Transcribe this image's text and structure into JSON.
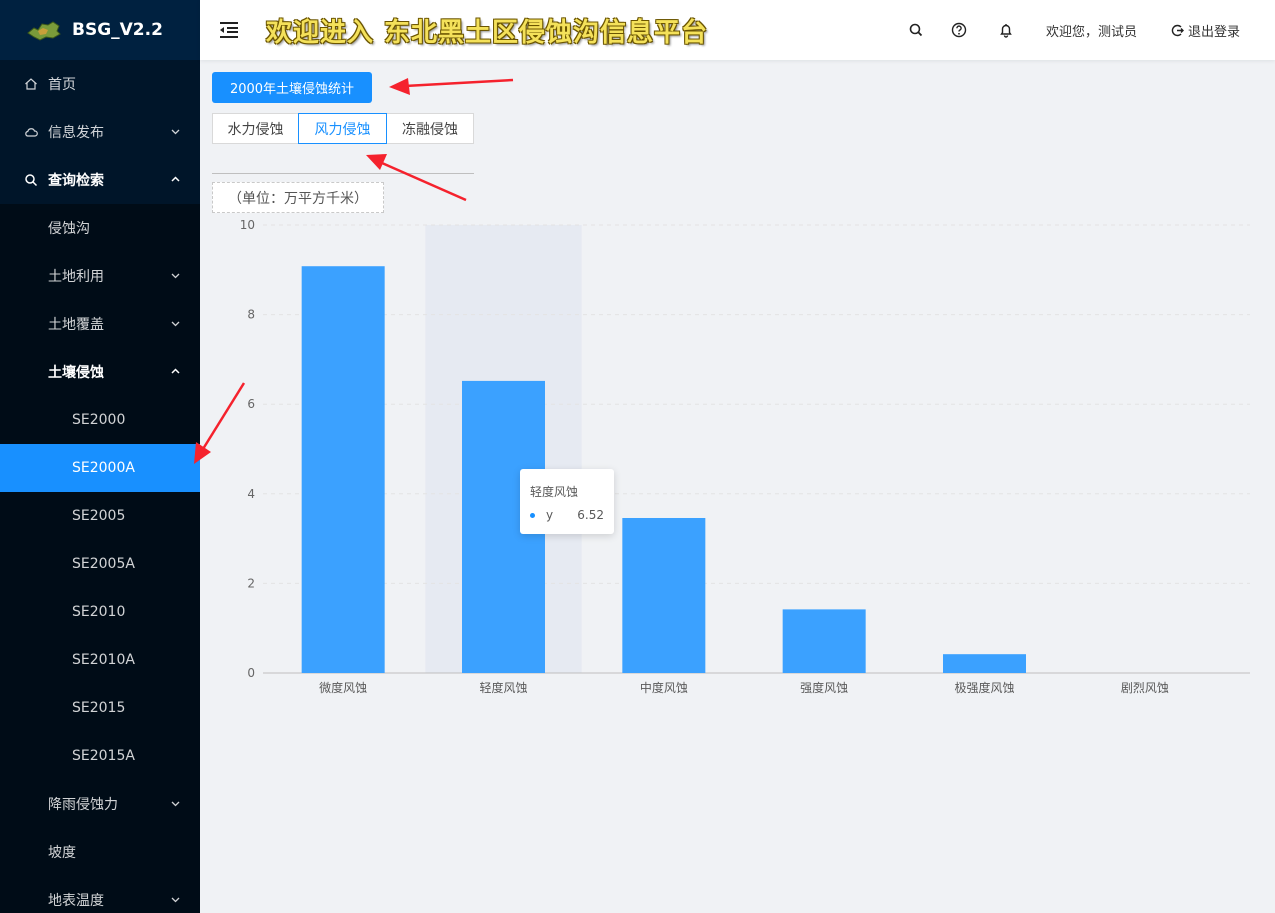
{
  "app": {
    "name": "BSG_V2.2"
  },
  "sidebar": {
    "items": [
      {
        "label": "首页",
        "icon": "home-icon"
      },
      {
        "label": "信息发布",
        "icon": "cloud-icon"
      },
      {
        "label": "查询检索",
        "icon": "search-icon"
      },
      {
        "label": "侵蚀沟"
      },
      {
        "label": "土地利用"
      },
      {
        "label": "土地覆盖"
      },
      {
        "label": "土壤侵蚀"
      },
      {
        "label": "SE2000"
      },
      {
        "label": "SE2000A"
      },
      {
        "label": "SE2005"
      },
      {
        "label": "SE2005A"
      },
      {
        "label": "SE2010"
      },
      {
        "label": "SE2010A"
      },
      {
        "label": "SE2015"
      },
      {
        "label": "SE2015A"
      },
      {
        "label": "降雨侵蚀力"
      },
      {
        "label": "坡度"
      },
      {
        "label": "地表温度"
      }
    ],
    "selected": "SE2000A"
  },
  "header": {
    "title": "欢迎进入 东北黑土区侵蚀沟信息平台",
    "welcome": "欢迎您，测试员",
    "logout": "退出登录"
  },
  "main": {
    "stat_button": "2000年土壤侵蚀统计",
    "tabs": [
      {
        "label": "水力侵蚀",
        "active": false
      },
      {
        "label": "风力侵蚀",
        "active": true
      },
      {
        "label": "冻融侵蚀",
        "active": false
      }
    ],
    "unit_label": "（单位：万平方千米）"
  },
  "colors": {
    "sidebar": "#001529",
    "accent": "#1890ff",
    "bar": "#3ba1ff",
    "arrow": "#f5222d"
  },
  "chart_data": {
    "type": "bar",
    "categories": [
      "微度风蚀",
      "轻度风蚀",
      "中度风蚀",
      "强度风蚀",
      "极强度风蚀",
      "剧烈风蚀"
    ],
    "values": [
      9.08,
      6.52,
      3.46,
      1.42,
      0.42,
      0
    ],
    "ylim": [
      0,
      10
    ],
    "yticks": [
      "0",
      "2",
      "4",
      "6",
      "8",
      "10"
    ],
    "grid": true,
    "highlighted_category": "轻度风蚀"
  },
  "tooltip": {
    "title": "轻度风蚀",
    "series": "y",
    "value": "6.52"
  }
}
